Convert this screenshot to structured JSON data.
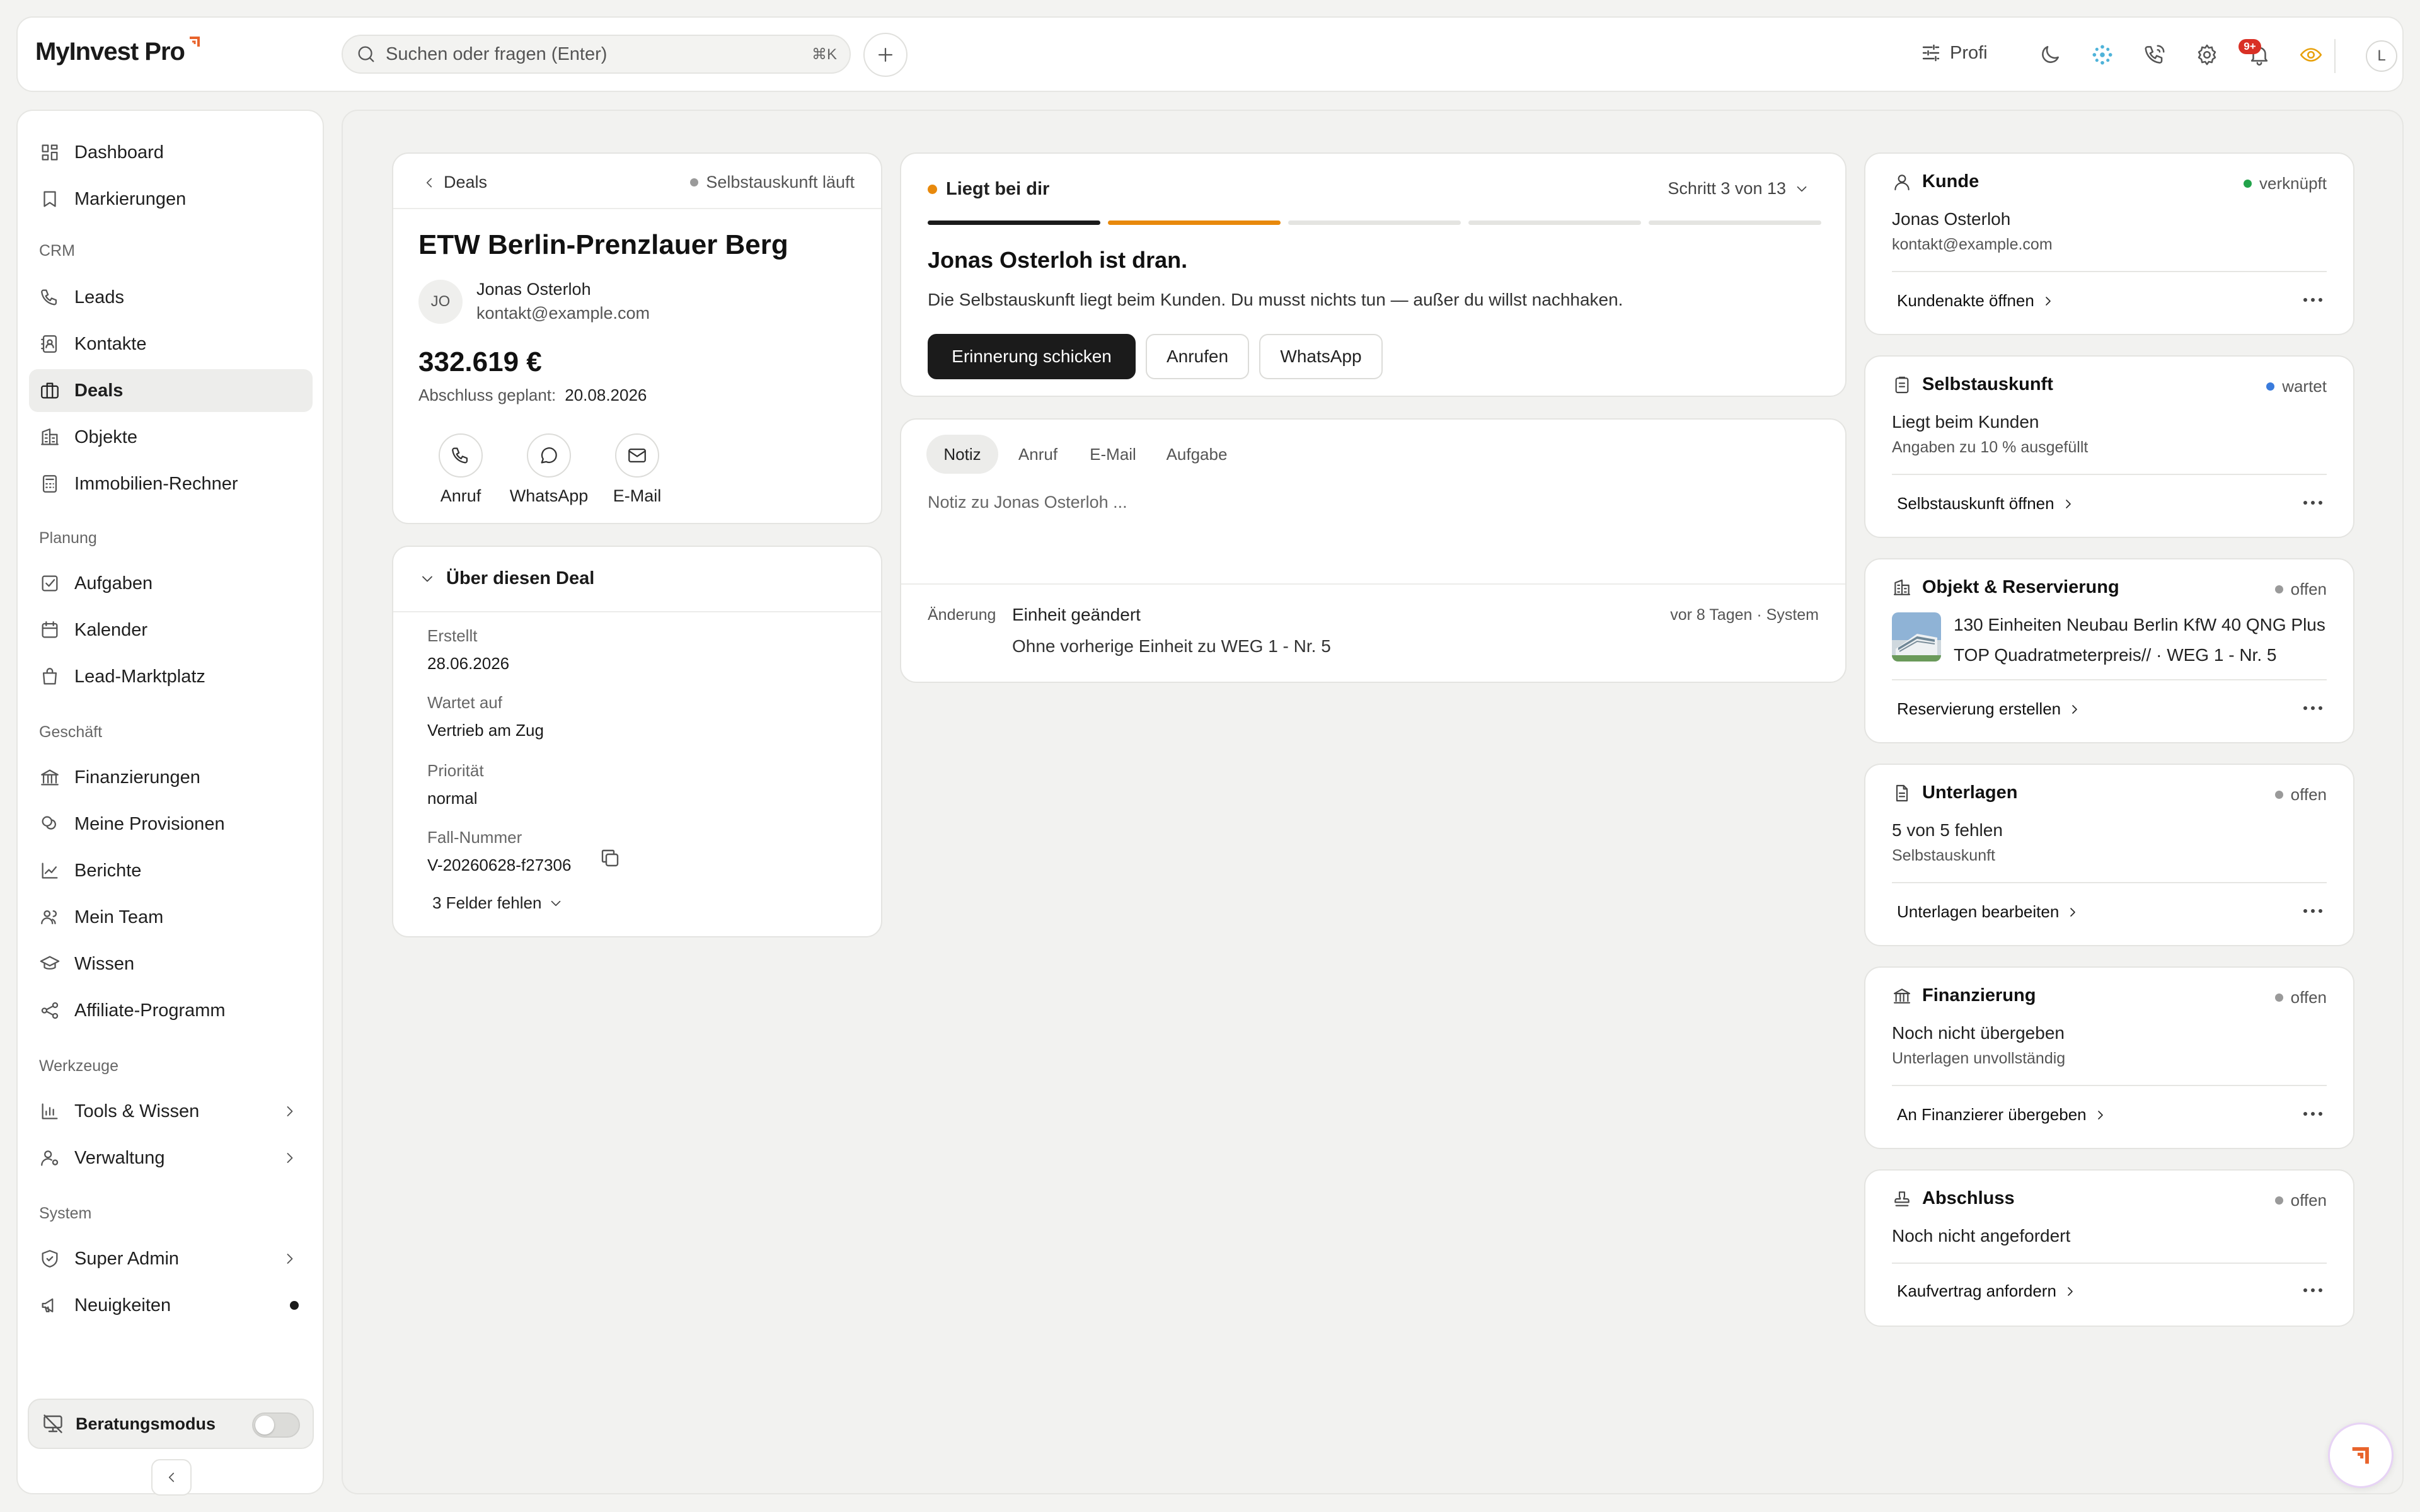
{
  "brand": {
    "name": "MyInvest Pro",
    "accent": "#e8632b"
  },
  "search": {
    "placeholder": "Suchen oder fragen (Enter)",
    "shortcut": "⌘K"
  },
  "topbar": {
    "profile_mode": "Profi",
    "notification_badge": "9+",
    "avatar_initial": "L"
  },
  "sidebar": {
    "items": [
      {
        "label": "Dashboard",
        "icon": "dashboard-icon"
      },
      {
        "label": "Markierungen",
        "icon": "bookmark-icon"
      }
    ],
    "groups": [
      {
        "title": "CRM",
        "items": [
          {
            "label": "Leads",
            "icon": "phone-icon"
          },
          {
            "label": "Kontakte",
            "icon": "contacts-icon"
          },
          {
            "label": "Deals",
            "icon": "briefcase-icon",
            "active": true
          },
          {
            "label": "Objekte",
            "icon": "building-icon"
          },
          {
            "label": "Immobilien-Rechner",
            "icon": "calculator-icon"
          }
        ]
      },
      {
        "title": "Planung",
        "items": [
          {
            "label": "Aufgaben",
            "icon": "checkbox-icon"
          },
          {
            "label": "Kalender",
            "icon": "calendar-icon"
          },
          {
            "label": "Lead-Marktplatz",
            "icon": "shopping-bag-icon"
          }
        ]
      },
      {
        "title": "Geschäft",
        "items": [
          {
            "label": "Finanzierungen",
            "icon": "bank-icon"
          },
          {
            "label": "Meine Provisionen",
            "icon": "coins-icon"
          },
          {
            "label": "Berichte",
            "icon": "chart-line-icon"
          },
          {
            "label": "Mein Team",
            "icon": "users-icon"
          },
          {
            "label": "Wissen",
            "icon": "graduation-cap-icon"
          },
          {
            "label": "Affiliate-Programm",
            "icon": "share-icon"
          }
        ]
      },
      {
        "title": "Werkzeuge",
        "items": [
          {
            "label": "Tools & Wissen",
            "icon": "bar-chart-icon"
          },
          {
            "label": "Verwaltung",
            "icon": "user-cog-icon"
          }
        ]
      },
      {
        "title": "System",
        "items": [
          {
            "label": "Super Admin",
            "icon": "shield-icon"
          },
          {
            "label": "Neuigkeiten",
            "icon": "megaphone-icon"
          }
        ]
      }
    ],
    "beratungsmodus": {
      "label": "Beratungsmodus",
      "enabled": false
    }
  },
  "deal": {
    "breadcrumb": "Deals",
    "state": "Selbstauskunft läuft",
    "title": "ETW Berlin-Prenzlauer Berg",
    "contact": {
      "initials": "JO",
      "name": "Jonas Osterloh",
      "email": "kontakt@example.com"
    },
    "amount": "332.619 €",
    "close_label": "Abschluss geplant:",
    "close_date": "20.08.2026",
    "actions": {
      "call": "Anruf",
      "whatsapp": "WhatsApp",
      "email": "E-Mail"
    }
  },
  "about": {
    "title": "Über diesen Deal",
    "fields": [
      {
        "label": "Erstellt",
        "value": "28.06.2026"
      },
      {
        "label": "Wartet auf",
        "value": "Vertrieb am Zug"
      },
      {
        "label": "Priorität",
        "value": "normal"
      },
      {
        "label": "Fall-Nummer",
        "value": "V-20260628-f27306"
      }
    ],
    "missing": "3 Felder fehlen"
  },
  "status": {
    "label": "Liegt bei dir",
    "step": "Schritt 3 von 13",
    "progress_segments": 5,
    "progress_done": 2,
    "heading": "Jonas Osterloh ist dran.",
    "text": "Die Selbstauskunft liegt beim Kunden. Du musst nichts tun — außer du willst nachhaken.",
    "buttons": {
      "remind": "Erinnerung schicken",
      "call": "Anrufen",
      "whatsapp": "WhatsApp"
    }
  },
  "note": {
    "tabs": [
      "Notiz",
      "Anruf",
      "E-Mail",
      "Aufgabe"
    ],
    "active_tab": "Notiz",
    "placeholder": "Notiz zu Jonas Osterloh ...",
    "change": {
      "label": "Änderung",
      "title": "Einheit geändert",
      "meta": "vor 8 Tagen · System",
      "detail": "Ohne vorherige Einheit zu WEG 1 - Nr. 5"
    }
  },
  "cards": {
    "kunde": {
      "title": "Kunde",
      "status": "verknüpft",
      "line1": "Jonas Osterloh",
      "line2": "kontakt@example.com",
      "link": "Kundenakte öffnen"
    },
    "selbstauskunft": {
      "title": "Selbstauskunft",
      "status": "wartet",
      "line1": "Liegt beim Kunden",
      "line2": "Angaben zu 10 % ausgefüllt",
      "link": "Selbstauskunft öffnen"
    },
    "objekt": {
      "title": "Objekt & Reservierung",
      "status": "offen",
      "line1": "130 Einheiten Neubau Berlin KfW 40 QNG Plus TOP Quadratmeterpreis// · WEG 1 - Nr. 5",
      "link": "Reservierung erstellen"
    },
    "unterlagen": {
      "title": "Unterlagen",
      "status": "offen",
      "line1": "5 von 5 fehlen",
      "line2": "Selbstauskunft",
      "link": "Unterlagen bearbeiten"
    },
    "finanzierung": {
      "title": "Finanzierung",
      "status": "offen",
      "line1": "Noch nicht übergeben",
      "line2": "Unterlagen unvollständig",
      "link": "An Finanzierer übergeben"
    },
    "abschluss": {
      "title": "Abschluss",
      "status": "offen",
      "line1": "Noch nicht angefordert",
      "link": "Kaufvertrag anfordern"
    }
  },
  "colors": {
    "ok": "#22a34a",
    "waiting": "#3a7bdc",
    "open": "#9a9a9a",
    "active_step": "#e8890c",
    "done_step": "#1b1b1b"
  }
}
